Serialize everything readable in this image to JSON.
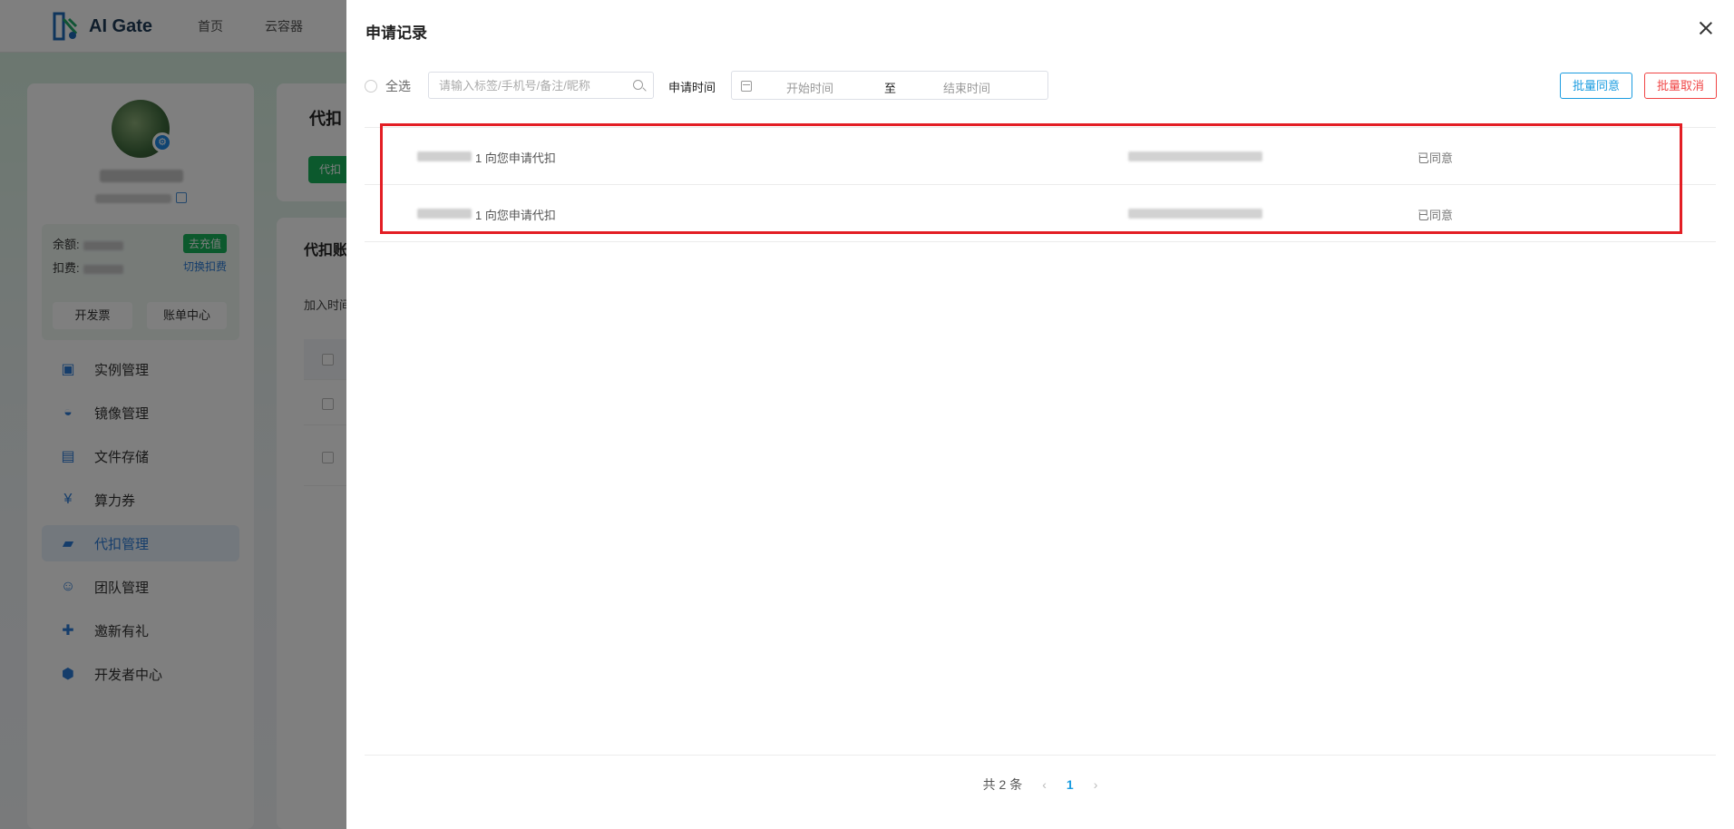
{
  "app": {
    "logo_text": "AI Gate",
    "nav": [
      "首页",
      "云容器"
    ]
  },
  "sidebar": {
    "wallet": {
      "balance_label": "余额:",
      "deduct_label": "扣费:",
      "recharge": "去充值",
      "switch": "切换扣费",
      "invoice": "开发票",
      "bills": "账单中心"
    },
    "items": [
      {
        "label": "实例管理",
        "icon": "instance-icon"
      },
      {
        "label": "镜像管理",
        "icon": "image-icon"
      },
      {
        "label": "文件存储",
        "icon": "storage-icon"
      },
      {
        "label": "算力券",
        "icon": "coupon-icon"
      },
      {
        "label": "代扣管理",
        "icon": "wallet-icon",
        "active": true
      },
      {
        "label": "团队管理",
        "icon": "team-icon"
      },
      {
        "label": "邀新有礼",
        "icon": "gift-icon"
      },
      {
        "label": "开发者中心",
        "icon": "developer-icon"
      }
    ]
  },
  "bg_cards": {
    "title1": "代扣",
    "btn1": "代扣",
    "title2": "代扣账",
    "label2": "加入时间"
  },
  "drawer": {
    "title": "申请记录",
    "select_all": "全选",
    "search_placeholder": "请输入标签/手机号/备注/昵称",
    "date_label": "申请时间",
    "date_start": "开始时间",
    "date_sep": "至",
    "date_end": "结束时间",
    "batch_approve": "批量同意",
    "batch_cancel": "批量取消",
    "records": [
      {
        "text": "1  向您申请代扣",
        "status": "已同意"
      },
      {
        "text": "1  向您申请代扣",
        "status": "已同意"
      }
    ],
    "pager": {
      "total": "共 2 条",
      "current": "1"
    }
  },
  "colors": {
    "primary": "#1a9ce0",
    "danger": "#f04444",
    "highlight": "#e31e24",
    "green": "#19b35a"
  }
}
